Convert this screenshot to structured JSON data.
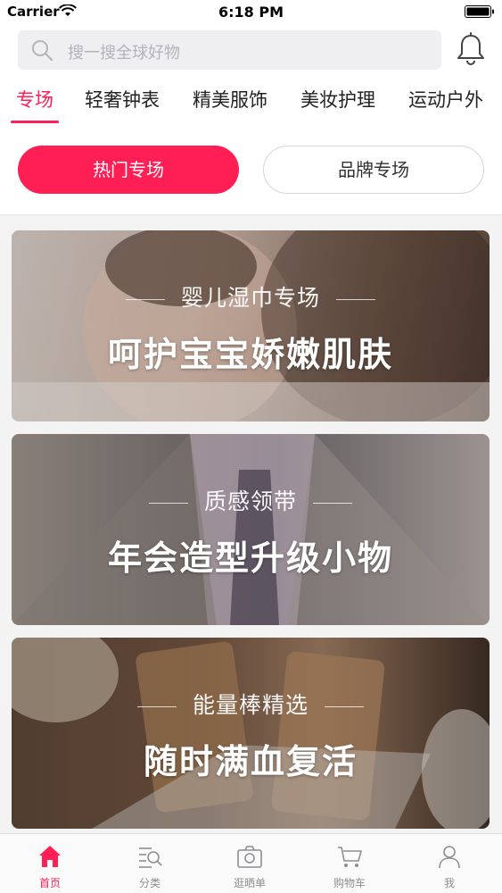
{
  "status_bar": {
    "carrier": "Carrier",
    "time": "6:18 PM"
  },
  "search": {
    "placeholder": "搜一搜全球好物"
  },
  "category_tabs": [
    {
      "label": "专场",
      "active": true
    },
    {
      "label": "轻奢钟表",
      "active": false
    },
    {
      "label": "精美服饰",
      "active": false
    },
    {
      "label": "美妆护理",
      "active": false
    },
    {
      "label": "运动户外",
      "active": false
    }
  ],
  "segments": {
    "hot": "热门专场",
    "brand": "品牌专场"
  },
  "banners": [
    {
      "subtitle": "婴儿湿巾专场",
      "title": "呵护宝宝娇嫩肌肤"
    },
    {
      "subtitle": "质感领带",
      "title": "年会造型升级小物"
    },
    {
      "subtitle": "能量棒精选",
      "title": "随时满血复活"
    }
  ],
  "tab_bar": [
    {
      "label": "首页",
      "icon": "home-icon",
      "active": true
    },
    {
      "label": "分类",
      "icon": "category-search-icon",
      "active": false
    },
    {
      "label": "逛晒单",
      "icon": "camera-icon",
      "active": false
    },
    {
      "label": "购物车",
      "icon": "cart-icon",
      "active": false
    },
    {
      "label": "我",
      "icon": "person-icon",
      "active": false
    }
  ],
  "colors": {
    "accent": "#ff1f55",
    "inactive": "#8e8e93"
  }
}
